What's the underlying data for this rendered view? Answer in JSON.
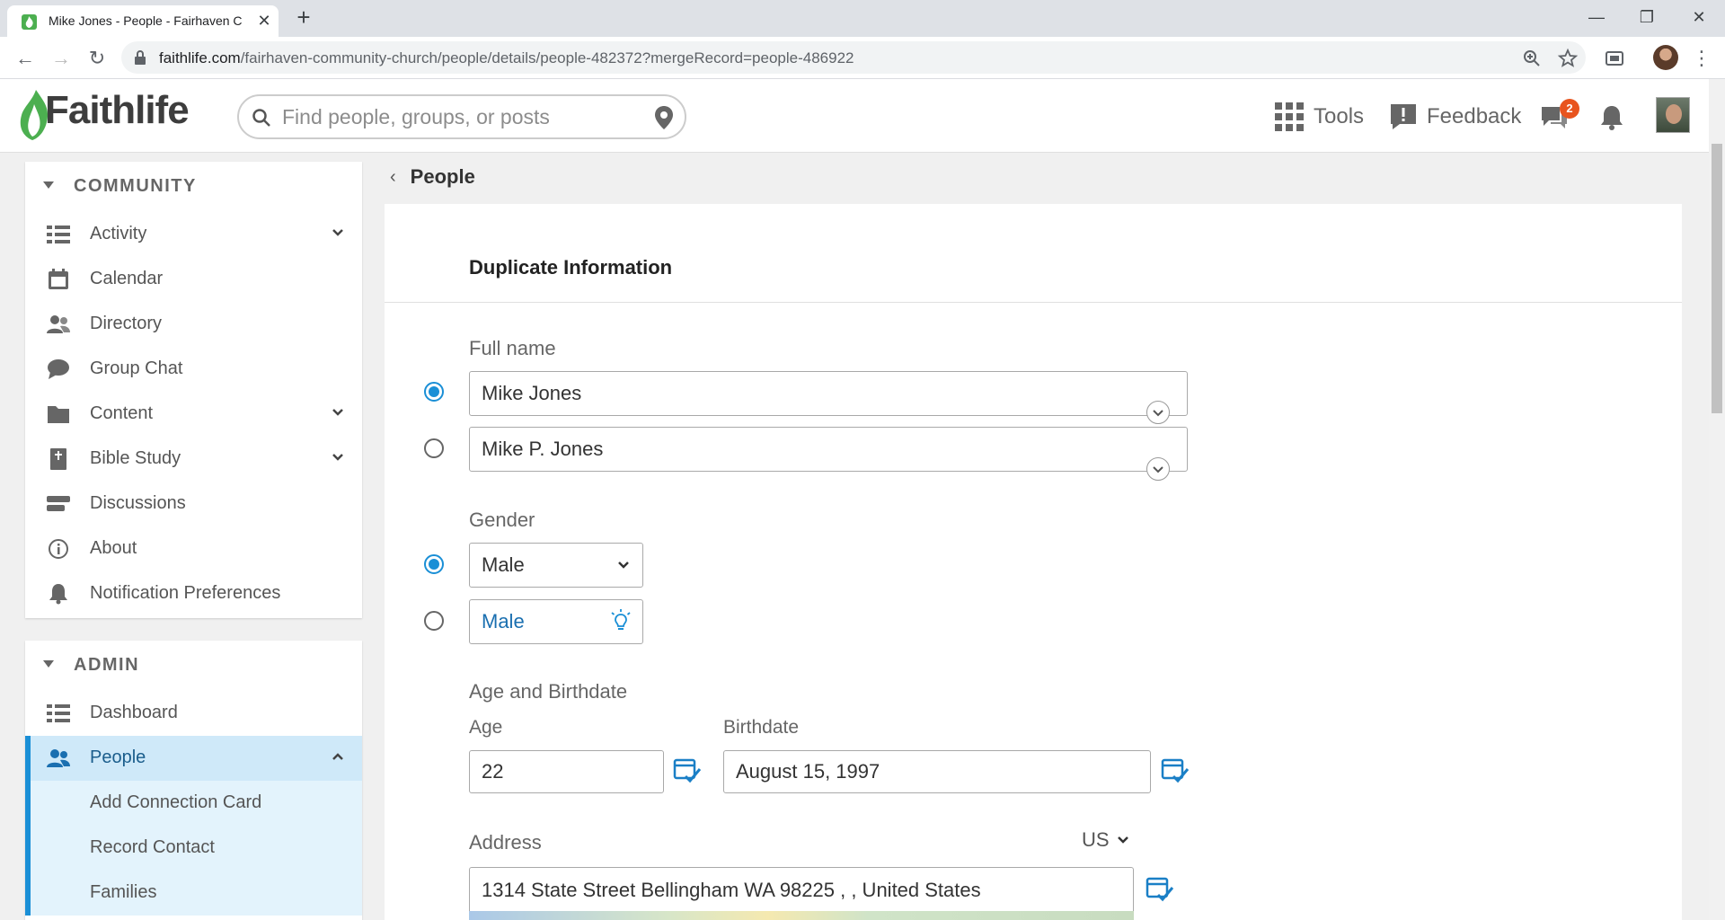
{
  "browser": {
    "tab_title": "Mike Jones - People - Fairhaven C",
    "url_host": "faithlife.com",
    "url_path": "/fairhaven-community-church/people/details/people-482372?mergeRecord=people-486922"
  },
  "header": {
    "logo_text": "Faithlife",
    "search_placeholder": "Find people, groups, or posts",
    "tools_label": "Tools",
    "feedback_label": "Feedback",
    "chat_badge": "2"
  },
  "sidebar": {
    "community_heading": "COMMUNITY",
    "community_items": [
      {
        "label": "Activity",
        "icon": "activity-icon",
        "expandable": true
      },
      {
        "label": "Calendar",
        "icon": "calendar-icon",
        "expandable": false
      },
      {
        "label": "Directory",
        "icon": "directory-icon",
        "expandable": false
      },
      {
        "label": "Group Chat",
        "icon": "chat-icon",
        "expandable": false
      },
      {
        "label": "Content",
        "icon": "folder-icon",
        "expandable": true
      },
      {
        "label": "Bible Study",
        "icon": "bible-icon",
        "expandable": true
      },
      {
        "label": "Discussions",
        "icon": "discussions-icon",
        "expandable": false
      },
      {
        "label": "About",
        "icon": "info-icon",
        "expandable": false
      },
      {
        "label": "Notification Preferences",
        "icon": "bell-icon",
        "expandable": false
      }
    ],
    "admin_heading": "ADMIN",
    "admin_items": [
      {
        "label": "Dashboard",
        "icon": "dashboard-icon"
      },
      {
        "label": "People",
        "icon": "people-icon",
        "active": true
      }
    ],
    "people_subitems": [
      "Add Connection Card",
      "Record Contact",
      "Families"
    ]
  },
  "main": {
    "breadcrumb": "People",
    "panel_title": "Duplicate Information",
    "full_name_label": "Full name",
    "full_name_options": [
      "Mike Jones",
      "Mike P. Jones"
    ],
    "gender_label": "Gender",
    "gender_options": [
      "Male",
      "Male"
    ],
    "age_birthdate_label": "Age and Birthdate",
    "age_label": "Age",
    "age_value": "22",
    "birthdate_label": "Birthdate",
    "birthdate_value": "August 15, 1997",
    "address_label": "Address",
    "country": "US",
    "address_value": "1314 State Street Bellingham WA 98225 ,  , United States"
  },
  "colors": {
    "accent": "#1a8fd6",
    "brand_green": "#4caf50",
    "badge": "#e8541e"
  }
}
